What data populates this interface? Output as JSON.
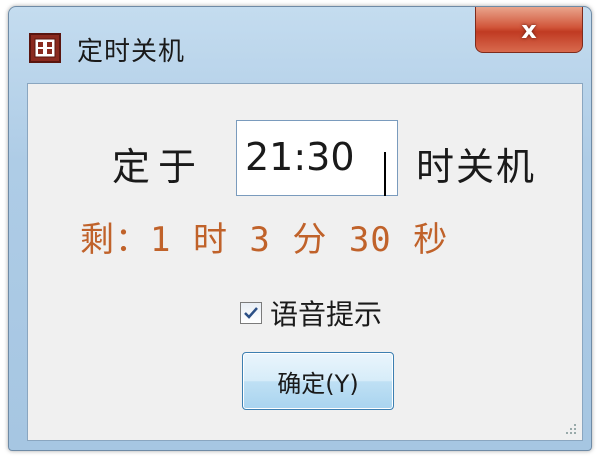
{
  "window": {
    "title": "定时关机",
    "icon": "clock-app-icon",
    "close_label": "x"
  },
  "main": {
    "label_at": "定于",
    "time_value": "21:30",
    "label_shutdown": "时关机",
    "remaining_text": "剩：1 时 3 分 30 秒",
    "voice_prompt": {
      "checked": true,
      "label": "语音提示"
    },
    "ok_label": "确定(Y)"
  },
  "colors": {
    "remaining_text": "#c0622a",
    "close_button": "#c03a22",
    "title_bar": "#aecce6"
  }
}
